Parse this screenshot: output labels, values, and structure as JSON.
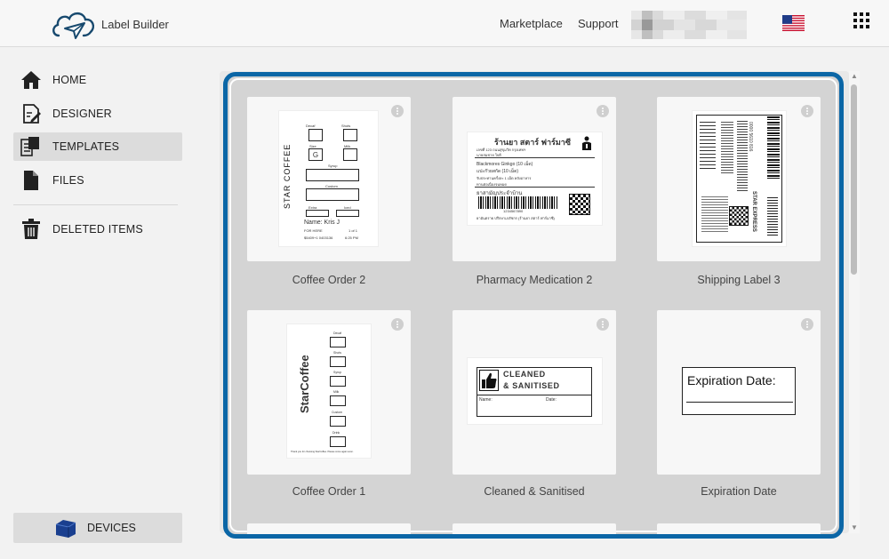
{
  "header": {
    "app_title": "Label Builder",
    "nav": [
      "Marketplace",
      "Support"
    ],
    "logo_icon": "cloud-logo-icon",
    "flag_icon": "us-flag-icon",
    "apps_icon": "grid-apps-icon"
  },
  "sidebar": {
    "items": [
      {
        "label": "HOME",
        "icon": "home-icon"
      },
      {
        "label": "DESIGNER",
        "icon": "designer-icon"
      },
      {
        "label": "TEMPLATES",
        "icon": "templates-icon",
        "active": true
      },
      {
        "label": "FILES",
        "icon": "file-icon"
      },
      {
        "label": "DELETED ITEMS",
        "icon": "trash-icon"
      }
    ],
    "devices_label": "DEVICES"
  },
  "templates": [
    {
      "title": "Coffee Order 2",
      "thumb": {
        "brand": "STAR COFFEE",
        "fields": [
          "Decaf",
          "Shots",
          "Size",
          "Milk",
          "Syrup",
          "Custom",
          "Extra",
          "Iced"
        ],
        "size_value": "G",
        "name_line": "Name: Kris J",
        "line2_left": "FOR HERE",
        "line2_right": "1 of 1",
        "line3_left": "$5409+1 0403136",
        "line3_right": "6:25 PM"
      }
    },
    {
      "title": "Pharmacy Medication 2",
      "thumb": {
        "heading": "ร้านยา สตาร์ ฟาร์มาซี",
        "sub1": "เลขที่ 123 ถนนสุขุมวิท กรุงเทพฯ",
        "sub2": "นายสมชาย ใจดี",
        "line1": "Blackmores Ginkgo (10 เม็ด)",
        "line2": "แปะก๊วยสกัด (10 เม็ด)",
        "line3": "รับประทานครั้งละ 1 เม็ด หลังอาหาร",
        "line4": "ทานต่อเนื่องจนหมด",
        "line5": "ยาสามัญประจำบ้าน",
        "barcode_num": "1234567890",
        "footer": "ยาอันตราย ปรึกษาเภสัชกร (ร้านยา สตาร์ ฟาร์มาซี)"
      }
    },
    {
      "title": "Shipping Label 3",
      "thumb": {
        "brand": "STAR EXPRESS",
        "code": "0000 5610 816"
      }
    },
    {
      "title": "Coffee Order 1",
      "thumb": {
        "brand": "StarCoffee",
        "fields": [
          "Decaf",
          "Shots",
          "Syrup",
          "Milk",
          "Custom",
          "Drink"
        ],
        "footer": "Thank you for choosing StarCoffee. Please come again soon."
      }
    },
    {
      "title": "Cleaned & Sanitised",
      "thumb": {
        "line1": "CLEANED",
        "line2": "& SANITISED",
        "name_label": "Name:",
        "date_label": "Date:"
      }
    },
    {
      "title": "Expiration Date",
      "thumb": {
        "text": "Expiration Date:"
      }
    }
  ]
}
